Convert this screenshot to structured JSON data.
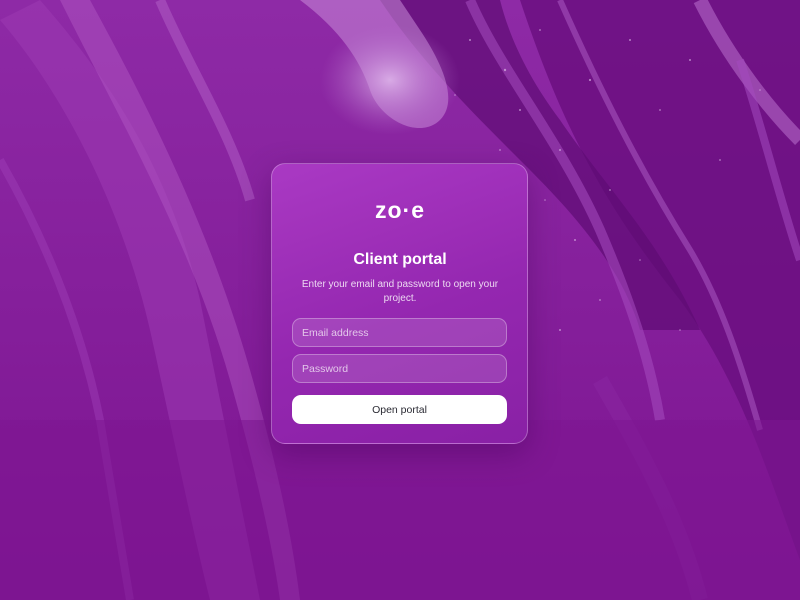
{
  "colors": {
    "background": "#7a1a8f",
    "card": "#9f2fbc",
    "button_background": "#ffffff",
    "button_text": "#2a2a33"
  },
  "brand": {
    "logo_text": "zo·e"
  },
  "login": {
    "title": "Client portal",
    "subtitle": "Enter your email and password to open your project.",
    "email_placeholder": "Email address",
    "email_value": "",
    "password_placeholder": "Password",
    "password_value": "",
    "submit_label": "Open portal"
  }
}
